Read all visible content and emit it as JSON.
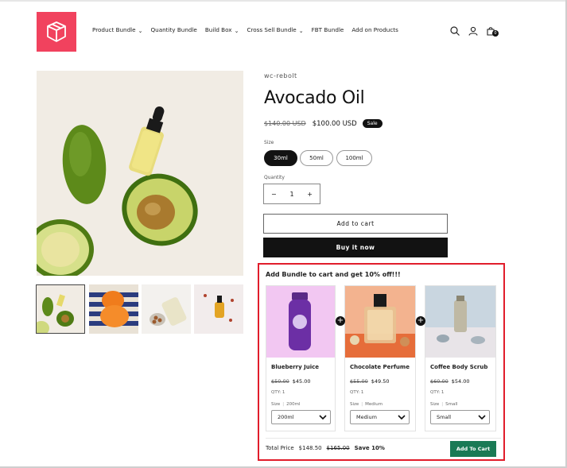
{
  "header": {
    "nav": [
      {
        "label": "Product Bundle",
        "has_dropdown": true
      },
      {
        "label": "Quantity Bundle",
        "has_dropdown": false
      },
      {
        "label": "Build Box",
        "has_dropdown": true
      },
      {
        "label": "Cross Sell Bundle",
        "has_dropdown": true
      },
      {
        "label": "FBT Bundle",
        "has_dropdown": false
      },
      {
        "label": "Add on Products",
        "has_dropdown": false
      }
    ],
    "icons": [
      "search-icon",
      "account-icon",
      "cart-icon"
    ],
    "cart_count": "0",
    "logo_color": "#f1425e"
  },
  "product": {
    "vendor": "wc-rebolt",
    "title": "Avocado Oil",
    "price_old": "$140.00 USD",
    "price_new": "$100.00 USD",
    "sale_badge": "Sale",
    "size_label": "Size",
    "sizes": [
      "30ml",
      "50ml",
      "100ml"
    ],
    "selected_size": "30ml",
    "quantity_label": "Quantity",
    "quantity": "1",
    "qty_minus": "−",
    "qty_plus": "+",
    "add_to_cart": "Add to cart",
    "buy_now": "Buy it now"
  },
  "bundle": {
    "title": "Add Bundle to cart and get 10% off!!!",
    "items": [
      {
        "name": "Blueberry Juice",
        "price_old": "$50.00",
        "price_new": "$45.00",
        "qty": "QTY: 1",
        "size_label": "Size",
        "size_value": "200ml",
        "select_value": "200ml"
      },
      {
        "name": "Chocolate Perfume",
        "price_old": "$55.00",
        "price_new": "$49.50",
        "qty": "QTY: 1",
        "size_label": "Size",
        "size_value": "Medium",
        "select_value": "Medium"
      },
      {
        "name": "Coffee Body Scrub",
        "price_old": "$60.00",
        "price_new": "$54.00",
        "qty": "QTY: 1",
        "size_label": "Size",
        "size_value": "Small",
        "select_value": "Small"
      }
    ],
    "total_label": "Total Price",
    "total_price": "$148.50",
    "total_old": "$165.00",
    "save_text": "Save 10%",
    "add_button": "Add To Cart",
    "button_color": "#1a7a55",
    "border_color": "#e11d2b"
  }
}
